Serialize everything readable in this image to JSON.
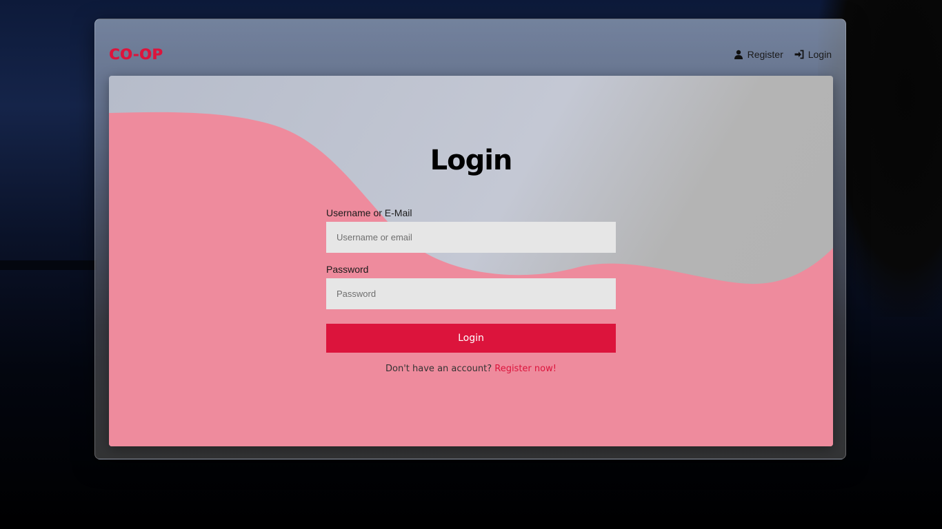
{
  "brand": {
    "logo_text": "CO-OP"
  },
  "nav": {
    "register_label": "Register",
    "login_label": "Login"
  },
  "form": {
    "title": "Login",
    "username_label": "Username or E-Mail",
    "username_placeholder": "Username or email",
    "password_label": "Password",
    "password_placeholder": "Password",
    "submit_label": "Login",
    "no_account_text": "Don't have an account?",
    "register_link_text": "Register now!"
  },
  "colors": {
    "accent": "#dc143c",
    "wave": "#ee8b9d",
    "input_bg": "#e6e6e6"
  },
  "icons": {
    "register": "user-icon",
    "login": "sign-in-icon"
  }
}
